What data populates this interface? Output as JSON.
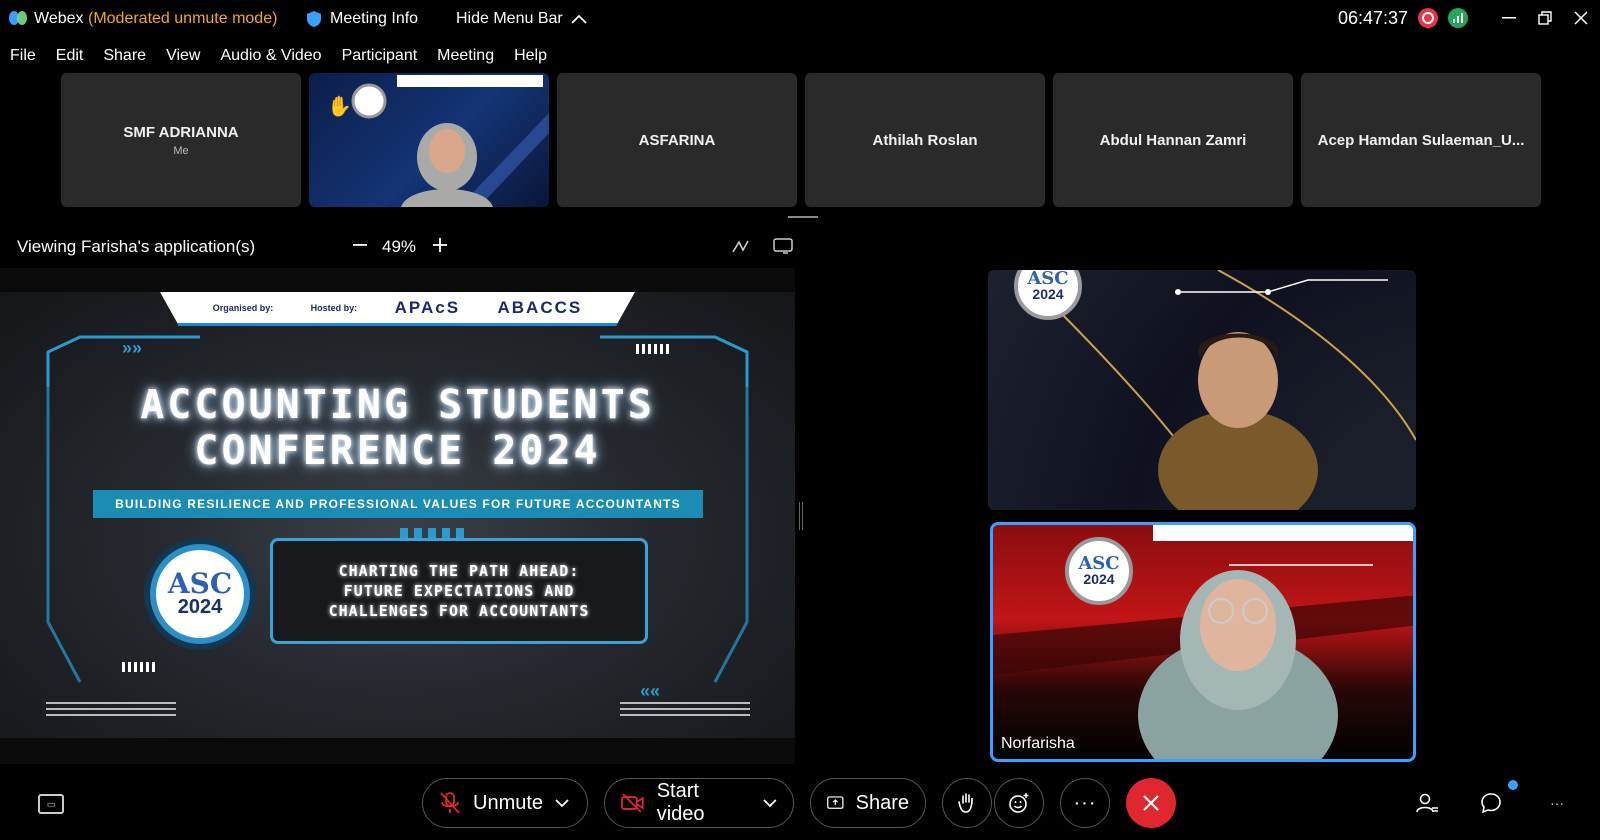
{
  "titlebar": {
    "app_name": "Webex",
    "mode": "(Moderated unmute mode)",
    "meeting_info": "Meeting Info",
    "hide_menu": "Hide Menu Bar",
    "clock": "06:47:37"
  },
  "menu": [
    "File",
    "Edit",
    "Share",
    "View",
    "Audio & Video",
    "Participant",
    "Meeting",
    "Help"
  ],
  "participants": [
    {
      "name": "SMF ADRIANNA",
      "sub": "Me"
    },
    {
      "name": "",
      "sub": ""
    },
    {
      "name": "ASFARINA",
      "sub": ""
    },
    {
      "name": "Athilah Roslan",
      "sub": ""
    },
    {
      "name": "Abdul Hannan Zamri",
      "sub": ""
    },
    {
      "name": "Acep Hamdan Sulaeman_U...",
      "sub": ""
    }
  ],
  "viewing": {
    "label": "Viewing Farisha's application(s)",
    "zoom": "49%"
  },
  "slide": {
    "banner_org": "Organised by:",
    "banner_host": "Hosted by:",
    "banner_apacs": "APAcS",
    "banner_abccs": "ABACCS",
    "title_line1": "ACCOUNTING STUDENTS",
    "title_line2": "CONFERENCE 2024",
    "subtitle": "BUILDING RESILIENCE AND PROFESSIONAL VALUES FOR FUTURE ACCOUNTANTS",
    "logo_text": "ASC",
    "logo_year": "2024",
    "topic_line1": "CHARTING THE PATH AHEAD:",
    "topic_line2": "FUTURE EXPECTATIONS AND",
    "topic_line3": "CHALLENGES FOR ACCOUNTANTS"
  },
  "stage": {
    "top_logo_text": "ASC",
    "top_logo_year": "2024",
    "bottom_logo_text": "ASC",
    "bottom_logo_year": "2024",
    "speaker_name": "Norfarisha"
  },
  "controls": {
    "unmute": "Unmute",
    "start_video": "Start video",
    "share": "Share"
  },
  "colors": {
    "mode": "#f5a623",
    "leave": "#e0262f",
    "active_speaker": "#3aa0ff",
    "subtitle_bar": "#1b8db5"
  }
}
